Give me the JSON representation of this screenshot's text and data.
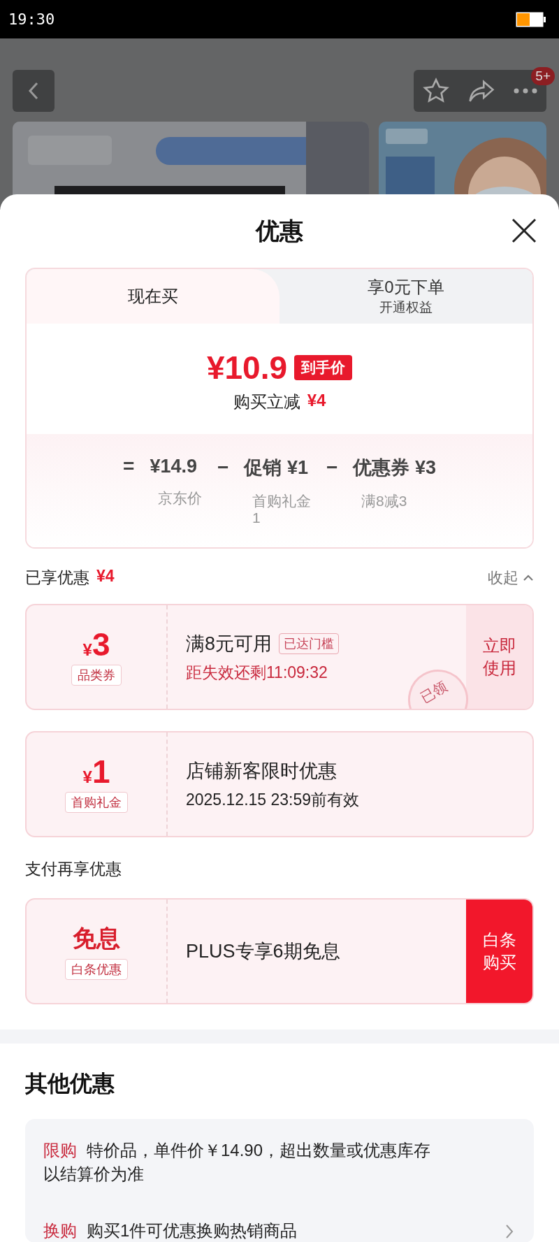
{
  "status_bar": {
    "time": "19:30"
  },
  "background_page": {
    "badge": "5+"
  },
  "sheet": {
    "title": "优惠"
  },
  "tabs": [
    {
      "label": "现在买",
      "selected": true
    },
    {
      "label": "享0元下单",
      "sublabel": "开通权益",
      "selected": false
    }
  ],
  "price": {
    "amount": "¥10.9",
    "tag": "到手价",
    "saving_label": "购买立减",
    "saving": "¥4"
  },
  "formula": [
    {
      "op": "=",
      "value": "¥14.9",
      "note": "京东价"
    },
    {
      "op": "−",
      "value": "促销 ¥1",
      "note": "首购礼金\n1"
    },
    {
      "op": "−",
      "value": "优惠券 ¥3",
      "note": "满8减3"
    }
  ],
  "applied": {
    "label": "已享优惠",
    "amount": "¥4",
    "collapse": "收起"
  },
  "coupons": [
    {
      "kind": "amount",
      "currency": "¥",
      "amount": "3",
      "type": "品类券",
      "title": "满8元可用",
      "badge": "已达门槛",
      "subtitle": "距失效还剩11:09:32",
      "action": "立即使用",
      "action_filled": false,
      "stamp": "已领"
    },
    {
      "kind": "amount",
      "currency": "¥",
      "amount": "1",
      "type": "首购礼金",
      "title": "店铺新客限时优惠",
      "subtitle": "2025.12.15 23:59前有效"
    }
  ],
  "payment": {
    "title": "支付再享优惠",
    "offers": [
      {
        "kind": "headline",
        "headline": "免息",
        "type": "白条优惠",
        "title": "PLUS专享6期免息",
        "action": "白条购买",
        "action_filled": true
      }
    ]
  },
  "other": {
    "title": "其他优惠",
    "rows": [
      {
        "tag": "限购",
        "text": "特价品，单件价￥14.90，超出数量或优惠库存以结算价为准",
        "chevron": false
      },
      {
        "tag": "换购",
        "text": "购买1件可优惠换购热销商品",
        "chevron": true
      }
    ]
  }
}
